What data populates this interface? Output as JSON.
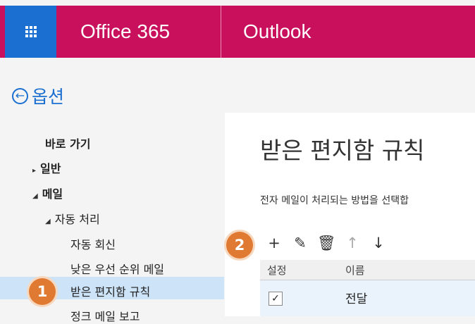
{
  "header": {
    "brand": "Office 365",
    "app": "Outlook"
  },
  "options": {
    "back_label": "옵션"
  },
  "nav": {
    "shortcuts": "바로 가기",
    "general": "일반",
    "mail": "메일",
    "auto_processing": "자동 처리",
    "auto_reply": "자동 회신",
    "low_priority": "낮은 우선 순위 메일",
    "inbox_rules": "받은 편지함 규칙",
    "junk_report": "정크 메일 보고"
  },
  "main": {
    "title": "받은 편지함 규칙",
    "description": "전자 메일이 처리되는 방법을 선택합",
    "toolbar": {
      "add_icon": "plus-icon",
      "edit_icon": "pencil-icon",
      "delete_icon": "trash-icon",
      "up_icon": "arrow-up-icon",
      "down_icon": "arrow-down-icon"
    },
    "table": {
      "columns": [
        "설정",
        "이름"
      ],
      "rows": [
        {
          "enabled": true,
          "name": "전달"
        }
      ]
    }
  },
  "callouts": [
    "1",
    "2"
  ],
  "colors": {
    "header_bg": "#c8105c",
    "launcher_bg": "#1a6fd1",
    "link": "#1a6fd1",
    "selected": "#cde3f7",
    "callout": "#e07a33"
  }
}
